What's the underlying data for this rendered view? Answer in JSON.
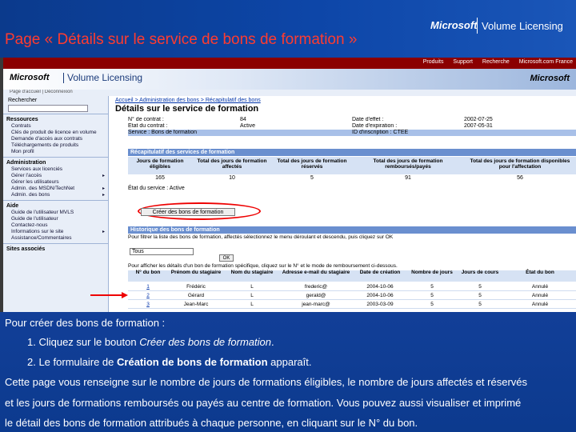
{
  "slide": {
    "title": "Page « Détails sur le service de bons de formation »",
    "logo_company": "Microsoft",
    "logo_product": "Volume Licensing"
  },
  "screenshot": {
    "top_nav": [
      "Produits",
      "Support",
      "Recherche",
      "Microsoft.com France"
    ],
    "ms_logo": "Microsoft",
    "ms_product": "Volume Licensing",
    "ms_logo_right": "Microsoft",
    "sub_bar": "Page d'accueil | Déconnexion",
    "sidebar": {
      "search_label": "Rechercher",
      "sections": [
        {
          "heading": "Ressources",
          "items": [
            "Contrats",
            "Clés de produit de licence en volume",
            "Demande d'accès aux contrats",
            "Téléchargements de produits",
            "Mon profil"
          ]
        },
        {
          "heading": "Administration",
          "items": [
            "Services aux licenciés",
            "Gérer l'accès",
            "Gérer les utilisateurs",
            "Admin. des MSDN/TechNet",
            "Admin. des bons"
          ]
        },
        {
          "heading": "Aide",
          "items": [
            "Guide de l'utilisateur MVLS",
            "Guide de l'utilisateur",
            "Contactez-nous",
            "Informations sur le site",
            "Assistance/Commentaires"
          ]
        },
        {
          "heading": "Sites associés",
          "items": []
        }
      ]
    },
    "breadcrumb": "Accueil > Administration des bons > Récapitulatif des bons",
    "page_heading": "Détails sur le service de formation",
    "info": {
      "rows": [
        [
          "N° de contrat :",
          "84",
          "Date d'effet :",
          "2002-07-25"
        ],
        [
          "État du contrat :",
          "Active",
          "Date d'expiration :",
          "2007-05-31"
        ],
        [
          "Service : Bons de formation",
          "",
          "ID d'inscription : CTEE",
          ""
        ]
      ]
    },
    "summary": {
      "title": "Récapitulatif des services de formation",
      "headers": [
        "Jours de formation éligibles",
        "Total des jours de formation affectés",
        "Total des jours de formation réservés",
        "Total des jours de formation remboursés/payés",
        "Total des jours de formation disponibles pour l'affectation"
      ],
      "values": [
        "165",
        "10",
        "5",
        "91",
        "56"
      ]
    },
    "status": {
      "label": "État du service :",
      "value": "Active"
    },
    "create_button": "Créer des bons de formation",
    "history": {
      "title": "Historique des bons de formation",
      "instructions": "Pour filtrer la liste des bons de formation, affectés sélectionnez le menu déroulant et descendu, puis cliquez sur OK",
      "select_value": "Tous",
      "ok_label": "OK",
      "filter_text": "Pour afficher les détails d'un bon de formation spécifique, cliquez sur le N° et le mode de remboursement ci-dessous.",
      "headers": [
        "N° du bon",
        "Prénom du stagiaire",
        "Nom du stagiaire",
        "Adresse e-mail du stagiaire",
        "Date de création",
        "Nombre de jours",
        "Jours de cours",
        "État du bon"
      ],
      "rows": [
        [
          "1",
          "Frédéric",
          "L",
          "frederic@",
          "2004-10-06",
          "5",
          "5",
          "Annulé"
        ],
        [
          "2",
          "Gérard",
          "L",
          "gerald@",
          "2004-10-06",
          "5",
          "5",
          "Annulé"
        ],
        [
          "3",
          "Jean-Marc",
          "L",
          "jean-marc@",
          "2003-03-09",
          "5",
          "5",
          "Annulé"
        ]
      ]
    }
  },
  "text_area": {
    "intro": "Pour créer des bons de formation :",
    "step1_prefix": "1. Cliquez sur le bouton ",
    "step1_emph": "Créer des bons de formation",
    "step1_suffix": ".",
    "step2_prefix": "2. Le formulaire de ",
    "step2_emph": "Création de bons de formation",
    "step2_suffix": " apparaît.",
    "para_line1": "Cette page vous renseigne sur le nombre de jours de formations éligibles, le nombre de jours affectés et réservés",
    "para_line2": "et les jours de formations remboursés ou payés au centre de formation. Vous pouvez aussi visualiser et imprimé",
    "para_line3": "le détail des bons de formation attribués à chaque personne, en cliquant sur le N° du bon."
  }
}
